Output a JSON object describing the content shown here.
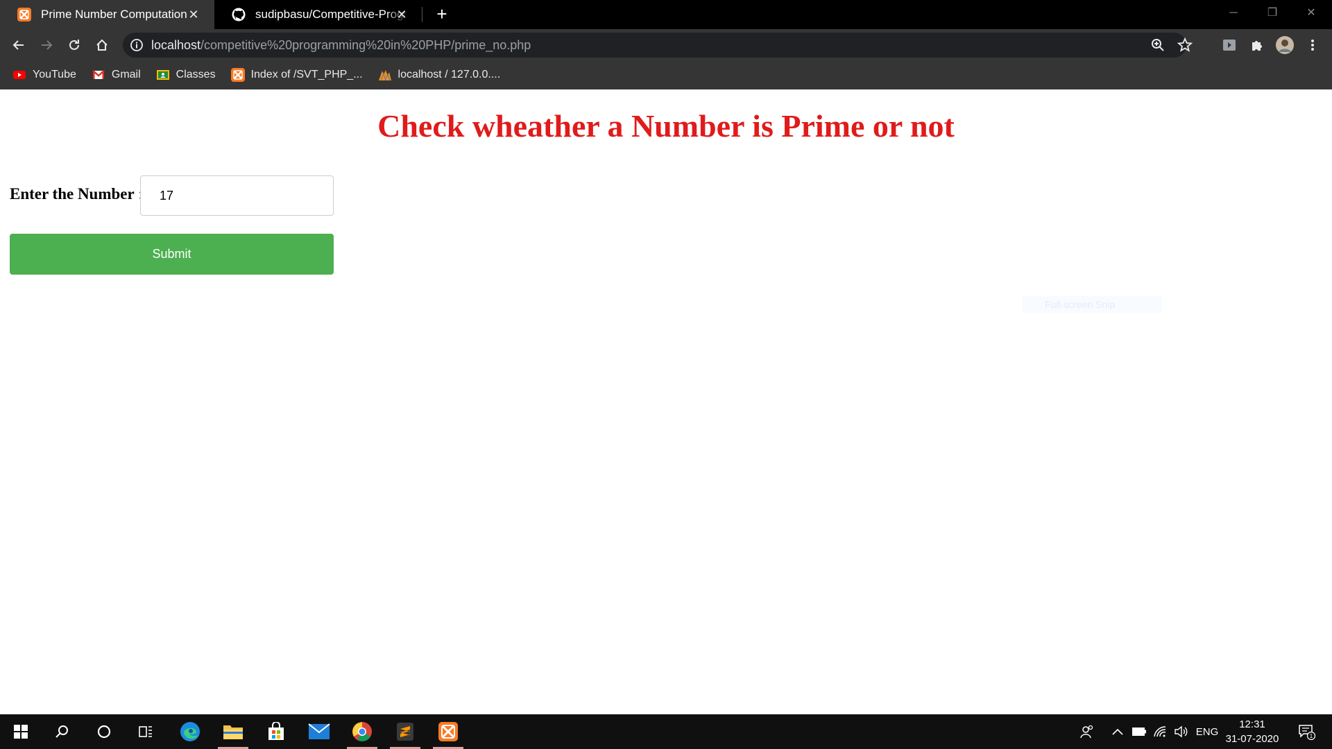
{
  "browser": {
    "tabs": [
      {
        "title": "Prime Number Computation",
        "favicon": "xampp-icon",
        "active": true
      },
      {
        "title": "sudipbasu/Competitive-Programming",
        "favicon": "github-icon",
        "active": false
      }
    ],
    "url_host": "localhost",
    "url_path": "/competitive%20programming%20in%20PHP/prime_no.php",
    "bookmarks": [
      {
        "label": "YouTube",
        "icon": "youtube-icon"
      },
      {
        "label": "Gmail",
        "icon": "gmail-icon"
      },
      {
        "label": "Classes",
        "icon": "classes-icon"
      },
      {
        "label": "Index of /SVT_PHP_...",
        "icon": "xampp-icon"
      },
      {
        "label": "localhost / 127.0.0....",
        "icon": "phpmyadmin-icon"
      }
    ]
  },
  "page": {
    "heading": "Check wheather a Number is Prime or not",
    "label": "Enter the Number",
    "label_suffix": " :",
    "input_value": "17",
    "submit_label": "Submit",
    "overlay_text": "Full-screen Snip"
  },
  "taskbar": {
    "language": "ENG",
    "time": "12:31",
    "date": "31-07-2020",
    "notification_count": "1"
  },
  "colors": {
    "heading": "#e01b1b",
    "submit_bg": "#4caf50",
    "chrome_bg": "#353535",
    "tabstrip_bg": "#000000",
    "taskbar_bg": "#101010"
  }
}
